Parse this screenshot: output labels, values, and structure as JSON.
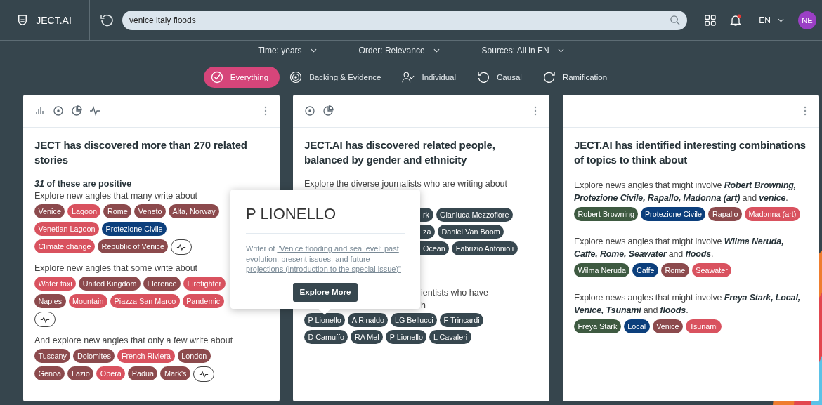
{
  "app": {
    "name": "JECT.AI"
  },
  "search": {
    "value": "venice italy floods"
  },
  "header": {
    "language": "EN",
    "avatar": "NE",
    "notification": true
  },
  "filters": [
    {
      "label": "Time: years"
    },
    {
      "label": "Order: Relevance"
    },
    {
      "label": "Sources: All in EN"
    }
  ],
  "tabs": [
    {
      "label": "Everything",
      "selected": true
    },
    {
      "label": "Backing & Evidence",
      "selected": false
    },
    {
      "label": "Individual",
      "selected": false
    },
    {
      "label": "Causal",
      "selected": false
    },
    {
      "label": "Ramification",
      "selected": false
    }
  ],
  "cards": [
    {
      "kind": "stories",
      "title": "JECT has discovered more than 270 related stories",
      "subtitle": "*31* of these are positive",
      "groups": [
        {
          "label": "Explore new angles that many write about",
          "trend_button": true,
          "chips": [
            {
              "label": "Venice",
              "color": "#8c4a4d"
            },
            {
              "label": "Lagoon",
              "color": "#d9525f"
            },
            {
              "label": "Rome",
              "color": "#8c4a4d"
            },
            {
              "label": "Veneto",
              "color": "#8c4a4d"
            },
            {
              "label": "Alta, Norway",
              "color": "#8c4a4d"
            },
            {
              "label": "Venetian Lagoon",
              "color": "#d9525f"
            },
            {
              "label": "Protezione Civile",
              "color": "#0c3f7c"
            },
            {
              "label": "Climate change",
              "color": "#d9525f"
            },
            {
              "label": "Republic of Venice",
              "color": "#8c4a4d"
            }
          ]
        },
        {
          "label": "Explore new angles that some write about",
          "trend_button": true,
          "chips": [
            {
              "label": "Water taxi",
              "color": "#d9525f"
            },
            {
              "label": "United Kingdom",
              "color": "#8c4a4d"
            },
            {
              "label": "Florence",
              "color": "#8c4a4d"
            },
            {
              "label": "Firefighter",
              "color": "#d9525f"
            },
            {
              "label": "Naples",
              "color": "#8c4a4d"
            },
            {
              "label": "Mountain",
              "color": "#d9525f"
            },
            {
              "label": "Piazza San Marco",
              "color": "#d9525f"
            },
            {
              "label": "Pandemic",
              "color": "#d9525f"
            }
          ]
        },
        {
          "label": "And explore new angles that only a few write about",
          "trend_button": true,
          "chips": [
            {
              "label": "Tuscany",
              "color": "#8c4a4d"
            },
            {
              "label": "Dolomites",
              "color": "#8c4a4d"
            },
            {
              "label": "French Riviera",
              "color": "#d9525f"
            },
            {
              "label": "London",
              "color": "#8c4a4d"
            },
            {
              "label": "Genoa",
              "color": "#8c4a4d"
            },
            {
              "label": "Lazio",
              "color": "#8c4a4d"
            },
            {
              "label": "Opera",
              "color": "#d9525f"
            },
            {
              "label": "Padua",
              "color": "#8c4a4d"
            },
            {
              "label": "Mark's",
              "color": "#8c4a4d"
            }
          ]
        }
      ]
    },
    {
      "kind": "people",
      "title": "JECT.AI has discovered related people, balanced by gender and ethnicity",
      "intro": "Explore the diverse journalists who are writing about",
      "journalist_rows": [
        [
          {
            "label": "rk",
            "cut": true
          },
          {
            "label": "Gianluca Mezzofiore",
            "cut": false
          }
        ],
        [
          {
            "label": "za",
            "cut": true
          },
          {
            "label": "Daniel Van Boom",
            "cut": false
          }
        ],
        [
          {
            "label": "Ocean",
            "cut": true
          },
          {
            "label": "Fabrizio Antonioli",
            "cut": false
          }
        ]
      ],
      "scientist_lines": [
        "ientists who have",
        "h"
      ],
      "scientist_rows": [
        [
          "P Lionello",
          "A Rinaldo",
          "LG Bellucci",
          "F Trincardi"
        ],
        [
          "D Camuffo",
          "RA Mel",
          "P Lionello",
          "L Cavaleri"
        ]
      ]
    },
    {
      "kind": "combinations",
      "title": "JECT.AI has identified interesting combinations of topics to think about",
      "angles": [
        {
          "text": "Explore news angles that might involve **Robert Browning, Protezione Civile, Rapallo, Madonna (art)** and **venice**.",
          "chips": [
            {
              "label": "Robert Browning",
              "color": "#3e5a41"
            },
            {
              "label": "Protezione Civile",
              "color": "#0c3f7c"
            },
            {
              "label": "Rapallo",
              "color": "#8c4a4d"
            },
            {
              "label": "Madonna (art)",
              "color": "#d9525f"
            }
          ]
        },
        {
          "text": "Explore news angles that might involve **Wilma Neruda, Caffe, Rome, Seawater** and **floods**.",
          "chips": [
            {
              "label": "Wilma Neruda",
              "color": "#3e5a41"
            },
            {
              "label": "Caffe",
              "color": "#0c3f7c"
            },
            {
              "label": "Rome",
              "color": "#8c4a4d"
            },
            {
              "label": "Seawater",
              "color": "#d9525f"
            }
          ]
        },
        {
          "text": "Explore news angles that might involve **Freya Stark, Local, Venice, Tsunami** and **floods**.",
          "chips": [
            {
              "label": "Freya Stark",
              "color": "#3e5a41"
            },
            {
              "label": "Local",
              "color": "#0c3f7c"
            },
            {
              "label": "Venice",
              "color": "#8c4a4d"
            },
            {
              "label": "Tsunami",
              "color": "#d9525f"
            }
          ]
        }
      ]
    }
  ],
  "popover": {
    "title": "P LIONELLO",
    "prefix": "Writer of",
    "link": "\"Venice flooding and sea level: past evolution, present issues, and future projections (introduction to the special issue)\"",
    "button": "Explore More"
  }
}
